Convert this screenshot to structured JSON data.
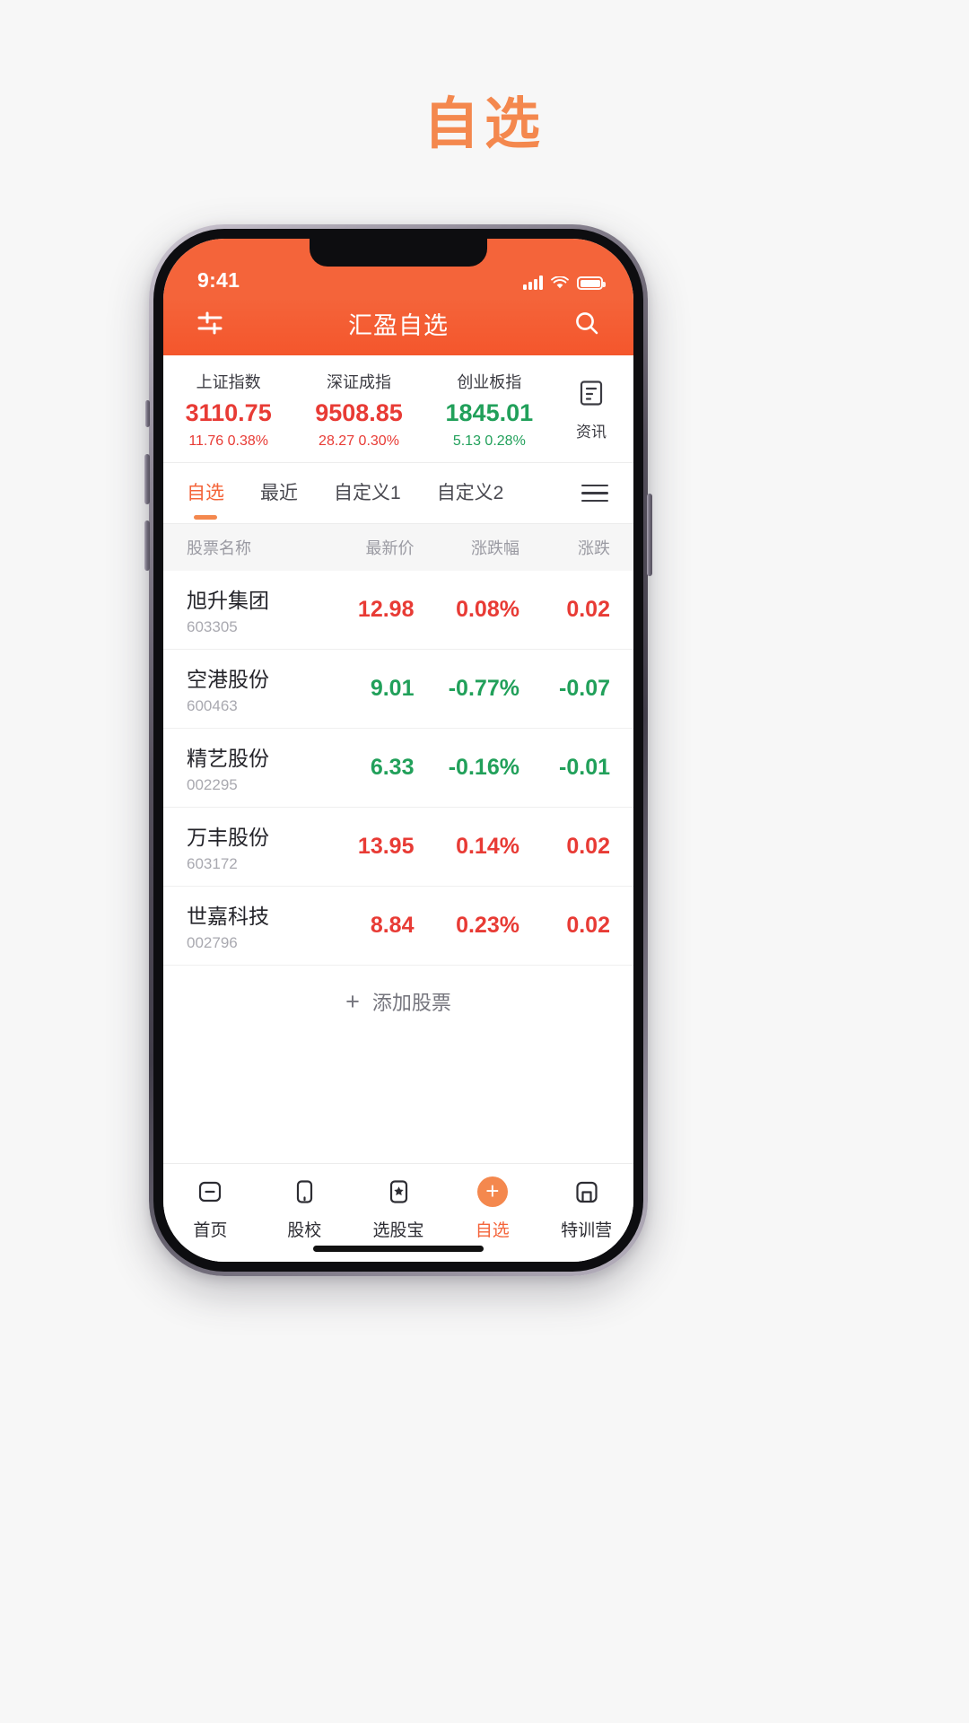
{
  "page": {
    "title": "自选",
    "title_color": "#f4884e",
    "background": "#f7f7f7"
  },
  "status_bar": {
    "time": "9:41",
    "signal_icon": "cellular-signal-icon",
    "wifi_icon": "wifi-icon",
    "battery_icon": "battery-icon"
  },
  "app_bar": {
    "title": "汇盈自选",
    "left_icon": "filter-sliders-icon",
    "right_icon": "search-icon",
    "background": "#f4562c"
  },
  "indices": [
    {
      "name": "上证指数",
      "value": "3110.75",
      "change": "11.76",
      "percent": "0.38%",
      "direction": "up"
    },
    {
      "name": "深证成指",
      "value": "9508.85",
      "change": "28.27",
      "percent": "0.30%",
      "direction": "up"
    },
    {
      "name": "创业板指",
      "value": "1845.01",
      "change": "5.13",
      "percent": "0.28%",
      "direction": "down"
    }
  ],
  "news_button": {
    "label": "资讯",
    "icon": "news-document-icon"
  },
  "tabs": [
    {
      "label": "自选",
      "active": true
    },
    {
      "label": "最近",
      "active": false
    },
    {
      "label": "自定义1",
      "active": false
    },
    {
      "label": "自定义2",
      "active": false
    }
  ],
  "tabs_menu_icon": "hamburger-menu-icon",
  "table": {
    "headers": [
      "股票名称",
      "最新价",
      "涨跌幅",
      "涨跌"
    ],
    "rows": [
      {
        "name": "旭升集团",
        "code": "603305",
        "price": "12.98",
        "percent": "0.08%",
        "change": "0.02",
        "direction": "up"
      },
      {
        "name": "空港股份",
        "code": "600463",
        "price": "9.01",
        "percent": "-0.77%",
        "change": "-0.07",
        "direction": "down"
      },
      {
        "name": "精艺股份",
        "code": "002295",
        "price": "6.33",
        "percent": "-0.16%",
        "change": "-0.01",
        "direction": "down"
      },
      {
        "name": "万丰股份",
        "code": "603172",
        "price": "13.95",
        "percent": "0.14%",
        "change": "0.02",
        "direction": "up"
      },
      {
        "name": "世嘉科技",
        "code": "002796",
        "price": "8.84",
        "percent": "0.23%",
        "change": "0.02",
        "direction": "up"
      }
    ],
    "add_label": "添加股票",
    "add_icon": "plus-icon"
  },
  "bottom_nav": [
    {
      "label": "首页",
      "icon": "home-icon",
      "active": false
    },
    {
      "label": "股校",
      "icon": "book-icon",
      "active": false
    },
    {
      "label": "选股宝",
      "icon": "star-pick-icon",
      "active": false
    },
    {
      "label": "自选",
      "icon": "plus-circle-icon",
      "active": true
    },
    {
      "label": "特训营",
      "icon": "camp-icon",
      "active": false
    }
  ],
  "colors": {
    "accent": "#f4643a",
    "accent_light": "#f4884e",
    "up": "#e83b35",
    "down": "#21a05a",
    "muted": "#9a9aa2"
  }
}
